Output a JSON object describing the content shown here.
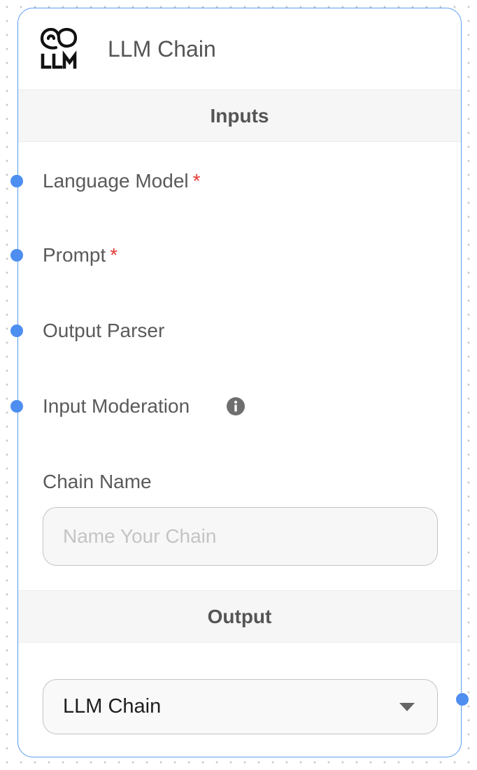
{
  "node": {
    "title": "LLM Chain",
    "logo_icon": "llm-logo-icon",
    "accent_color": "#4e8ef0"
  },
  "inputs_section": {
    "title": "Inputs",
    "params": [
      {
        "label": "Language Model",
        "required": "*"
      },
      {
        "label": "Prompt",
        "required": "*"
      },
      {
        "label": "Output Parser"
      },
      {
        "label": "Input Moderation",
        "icon": "info-icon"
      }
    ],
    "chain_name": {
      "label": "Chain Name",
      "value": "",
      "placeholder": "Name Your Chain"
    }
  },
  "output_section": {
    "title": "Output",
    "selected": "LLM Chain",
    "icon": "caret-down-icon"
  }
}
